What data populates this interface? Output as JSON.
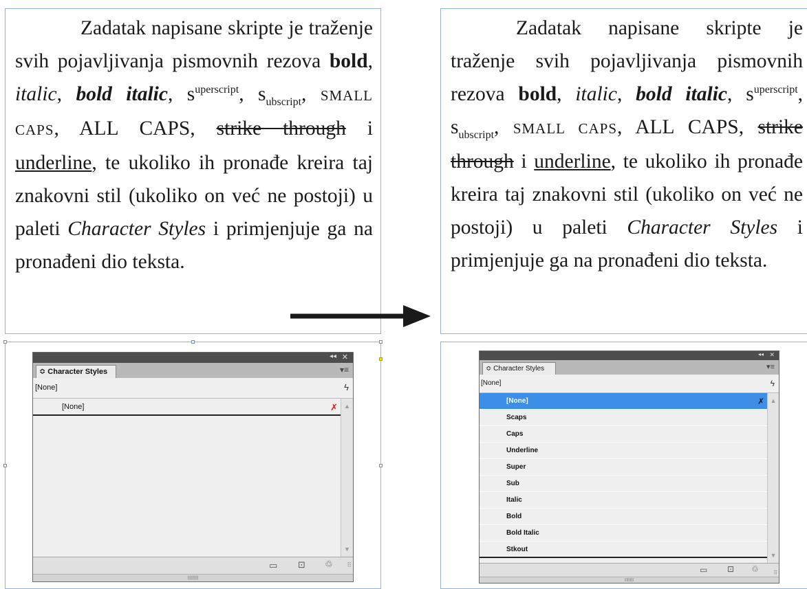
{
  "text_frames": {
    "paragraph": {
      "lead": "Zadatak napisane skripte je traženje svih pojavljivanja pismovnih rezova ",
      "bold": "bold",
      "comma1": ", ",
      "italic": "italic",
      "comma2": ", ",
      "bold_italic": "bold italic",
      "comma3": ", ",
      "sup_base": "s",
      "sup_text": "uperscript",
      "comma4": ", ",
      "sub_base": "s",
      "sub_text": "ubscript",
      "comma5": ", ",
      "small_caps": "SMALL CAPS",
      "comma6": ", ",
      "all_caps": "ALL CAPS",
      "comma7": ", ",
      "strike": "strike through",
      "i_word": " i ",
      "underline": "underline",
      "tail1": ", te ukoliko ih pronađe kreira taj znakovni stil (ukoliko on već ne postoji) u paleti ",
      "palette_name": "Character Styles",
      "tail2": " i primjenjuje ga na pronađeni dio teksta."
    }
  },
  "panel_before": {
    "title": "Character Styles",
    "current_style": "[None]",
    "items": [
      {
        "label": "[None]",
        "selected": false
      }
    ]
  },
  "panel_after": {
    "title": "Character Styles",
    "current_style": "[None]",
    "items": [
      {
        "label": "[None]",
        "selected": true
      },
      {
        "label": "Scaps",
        "selected": false
      },
      {
        "label": "Caps",
        "selected": false
      },
      {
        "label": "Underline",
        "selected": false
      },
      {
        "label": "Super",
        "selected": false
      },
      {
        "label": "Sub",
        "selected": false
      },
      {
        "label": "Italic",
        "selected": false
      },
      {
        "label": "Bold",
        "selected": false
      },
      {
        "label": "Bold Italic",
        "selected": false
      },
      {
        "label": "Stkout",
        "selected": false
      }
    ]
  },
  "icons": {
    "collapse": "double-chevron-left-icon",
    "close": "close-icon",
    "panel_menu": "panel-menu-icon",
    "quick_apply": "lightning-bolt-icon",
    "new_group": "folder-icon",
    "new_style": "new-style-icon",
    "delete": "trash-icon",
    "clear_override": "clear-override-icon"
  },
  "colors": {
    "frame_border": "#8fb2dc",
    "selection": "#3d8ee6",
    "panel_bg": "#e9e9e9"
  }
}
